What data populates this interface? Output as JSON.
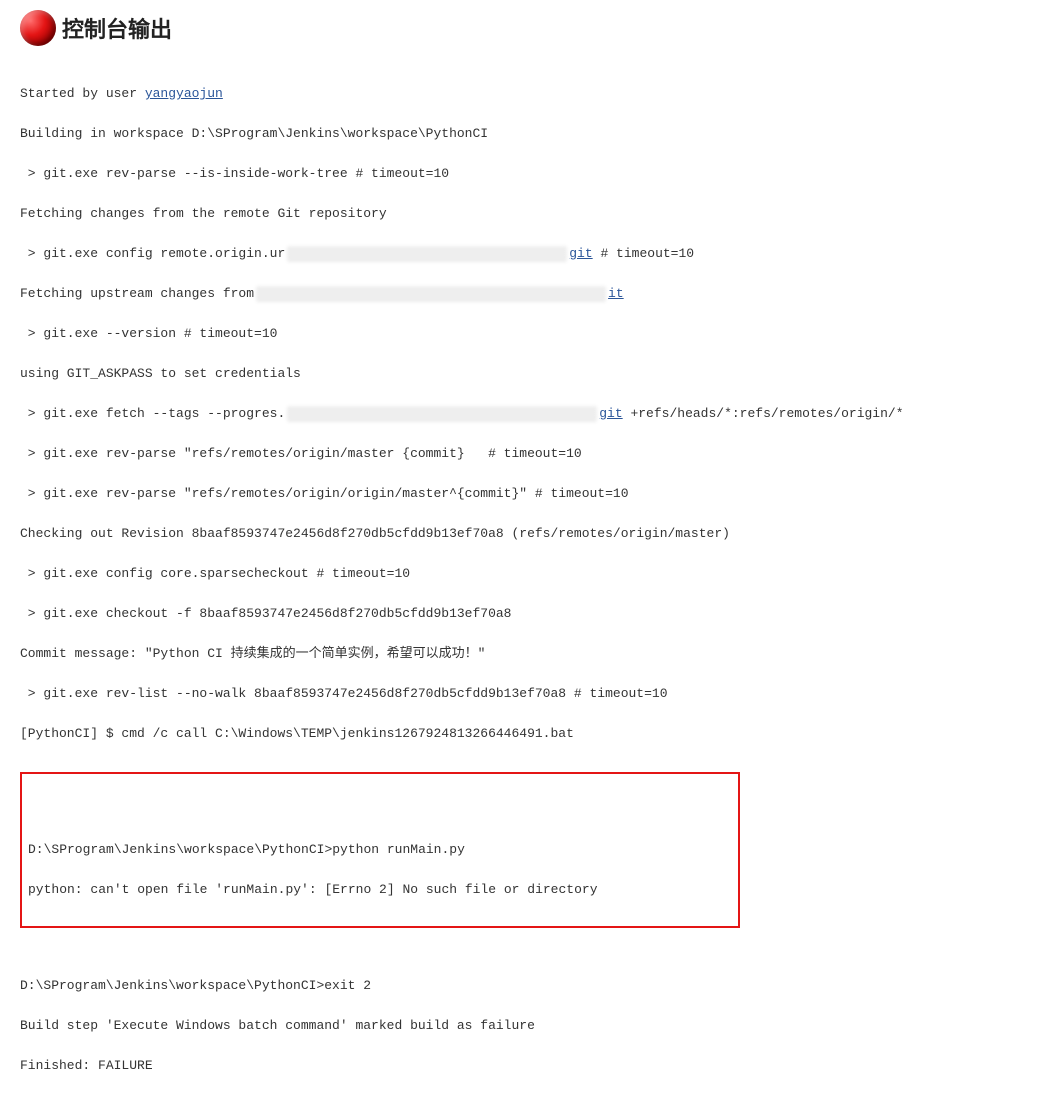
{
  "header": {
    "title": "控制台输出"
  },
  "user": {
    "prefix": "Started by user ",
    "name": "yangyaojun"
  },
  "lines": {
    "l2": "Building in workspace D:\\SProgram\\Jenkins\\workspace\\PythonCI",
    "l3": " > git.exe rev-parse --is-inside-work-tree # timeout=10",
    "l4": "Fetching changes from the remote Git repository",
    "l5a": " > git.exe config remote.origin.ur",
    "l5git": "git",
    "l5b": " # timeout=10",
    "l6a": "Fetching upstream changes from",
    "l6git": "it",
    "l7": " > git.exe --version # timeout=10",
    "l8": "using GIT_ASKPASS to set credentials ",
    "l9a": " > git.exe fetch --tags --progres.",
    "l9git": "git",
    "l9b": " +refs/heads/*:refs/remotes/origin/*",
    "l10a": " > git.exe rev-parse \"refs/remotes/origin/master {commit}   # timeout=10",
    "l11": " > git.exe rev-parse \"refs/remotes/origin/origin/master^{commit}\" # timeout=10",
    "l12": "Checking out Revision 8baaf8593747e2456d8f270db5cfdd9b13ef70a8 (refs/remotes/origin/master)",
    "l13": " > git.exe config core.sparsecheckout # timeout=10",
    "l14": " > git.exe checkout -f 8baaf8593747e2456d8f270db5cfdd9b13ef70a8",
    "l15": "Commit message: \"Python CI 持续集成的一个简单实例，希望可以成功！\"",
    "l16": " > git.exe rev-list --no-walk 8baaf8593747e2456d8f270db5cfdd9b13ef70a8 # timeout=10",
    "l17": "[PythonCI] $ cmd /c call C:\\Windows\\TEMP\\jenkins1267924813266446491.bat",
    "boxed1": "D:\\SProgram\\Jenkins\\workspace\\PythonCI>python runMain.py",
    "boxed2": "python: can't open file 'runMain.py': [Errno 2] No such file or directory",
    "l18": "D:\\SProgram\\Jenkins\\workspace\\PythonCI>exit 2 ",
    "l19": "Build step 'Execute Windows batch command' marked build as failure",
    "l20": "Finished: FAILURE"
  }
}
